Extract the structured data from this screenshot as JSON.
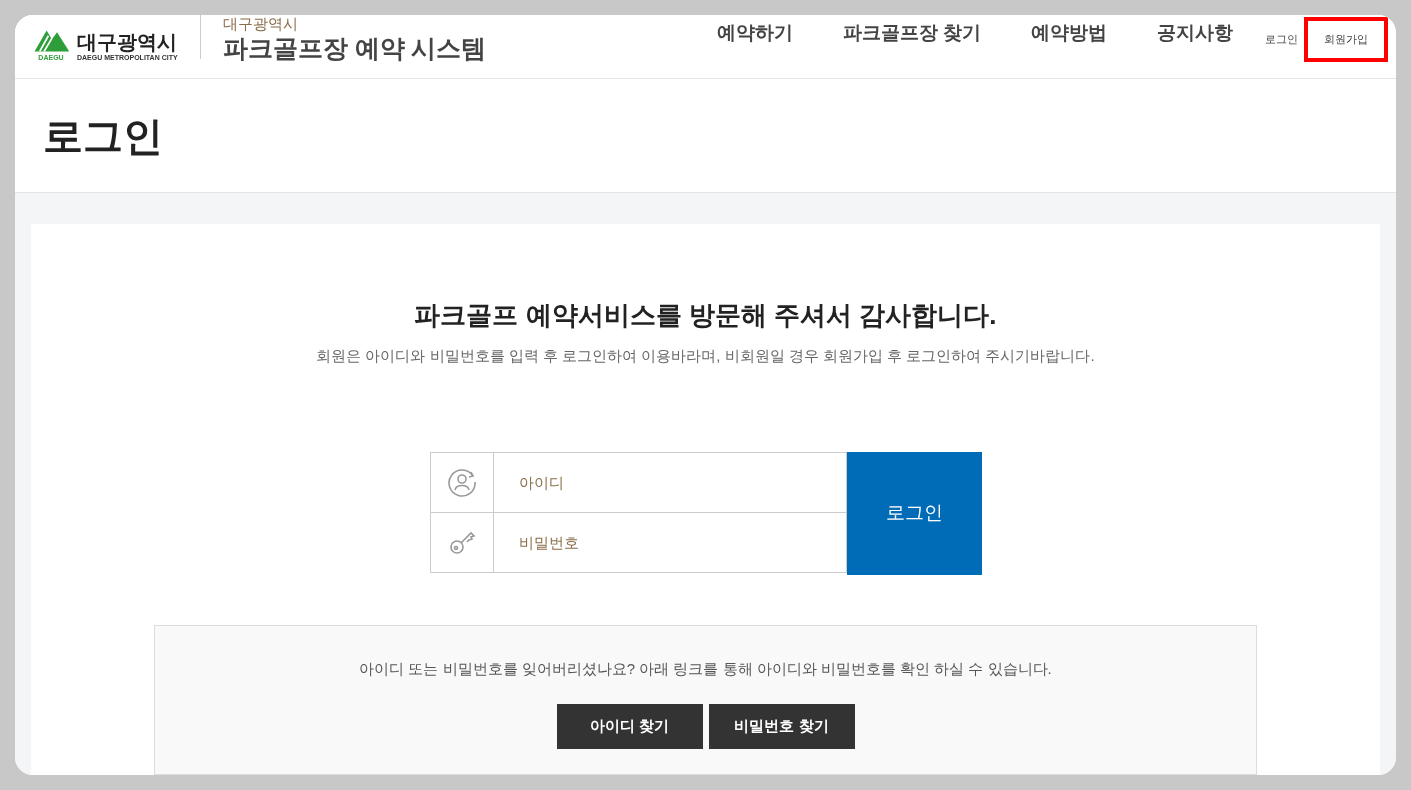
{
  "header": {
    "logo": {
      "name": "대구광역시",
      "subtitle": "DAEGU METROPOLITAN CITY",
      "badge": "DAEGU"
    },
    "site": {
      "overline": "대구광역시",
      "title": "파크골프장 예약 시스템"
    },
    "nav": [
      {
        "label": "예약하기"
      },
      {
        "label": "파크골프장 찾기"
      },
      {
        "label": "예약방법"
      },
      {
        "label": "공지사항"
      }
    ],
    "util_links": [
      {
        "label": "로그인",
        "highlighted": false
      },
      {
        "label": "회원가입",
        "highlighted": true
      }
    ]
  },
  "page_title": "로그인",
  "login": {
    "heading": "파크골프 예약서비스를 방문해 주셔서 감사합니다.",
    "description": "회원은 아이디와 비밀번호를 입력 후 로그인하여 이용바라며, 비회원일 경우 회원가입 후 로그인하여 주시기바랍니다.",
    "fields": [
      {
        "kind": "user",
        "placeholder": "아이디"
      },
      {
        "kind": "password",
        "placeholder": "비밀번호"
      }
    ],
    "submit": "로그인"
  },
  "help": {
    "text": "아이디 또는 비밀번호를 잊어버리셨나요? 아래 링크를 통해 아이디와 비밀번호를 확인 하실 수 있습니다.",
    "buttons": [
      "아이디 찾기",
      "비밀번호 찾기"
    ]
  }
}
